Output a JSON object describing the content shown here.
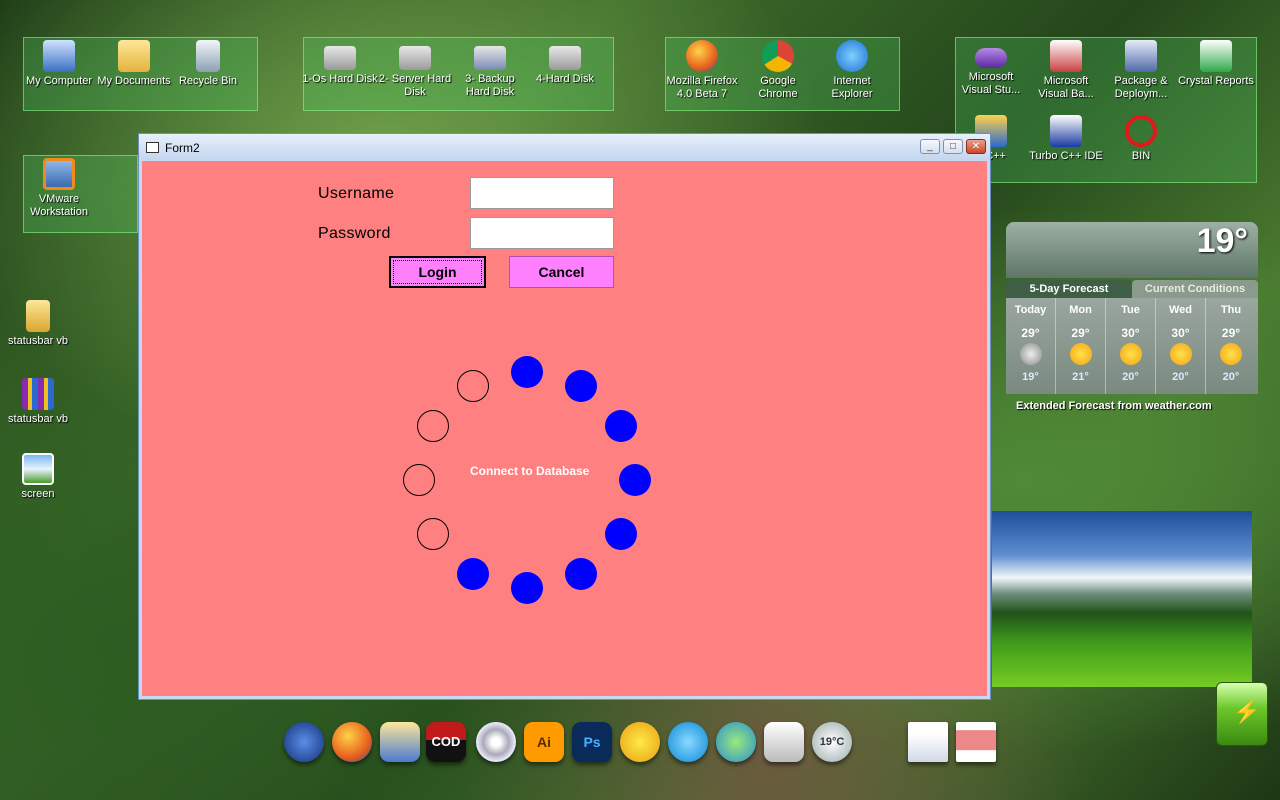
{
  "desktop": {
    "fence1": [
      {
        "label": "My Computer",
        "icon": "computer-icon"
      },
      {
        "label": "My Documents",
        "icon": "folder-icon"
      },
      {
        "label": "Recycle Bin",
        "icon": "recycle-bin-icon"
      }
    ],
    "fence2": [
      {
        "label": "1-Os Hard Disk",
        "icon": "hard-disk-icon"
      },
      {
        "label": "2- Server Hard Disk",
        "icon": "hard-disk-icon"
      },
      {
        "label": "3- Backup Hard Disk",
        "icon": "hard-disk-icon"
      },
      {
        "label": "4-Hard Disk",
        "icon": "hard-disk-icon"
      }
    ],
    "fence3": [
      {
        "label": "Mozilla Firefox 4.0 Beta 7",
        "icon": "firefox-icon"
      },
      {
        "label": "Google Chrome",
        "icon": "chrome-icon"
      },
      {
        "label": "Internet Explorer",
        "icon": "ie-icon"
      }
    ],
    "fence4": [
      {
        "label": "Microsoft Visual Stu...",
        "icon": "visual-studio-icon"
      },
      {
        "label": "Microsoft Visual Ba...",
        "icon": "visual-basic-icon"
      },
      {
        "label": "Package & Deploym...",
        "icon": "package-icon"
      },
      {
        "label": "Crystal Reports",
        "icon": "crystal-reports-icon"
      },
      {
        "label": "d C++",
        "icon": "cpp-icon"
      },
      {
        "label": "Turbo C++ IDE",
        "icon": "turbo-cpp-icon"
      },
      {
        "label": "BIN",
        "icon": "bin-icon"
      }
    ],
    "fence5": [
      {
        "label": "VMware Workstation",
        "icon": "vmware-icon"
      }
    ],
    "loose": [
      {
        "label": "statusbar vb",
        "icon": "folder-icon"
      },
      {
        "label": "statusbar vb",
        "icon": "archive-icon"
      },
      {
        "label": "screen",
        "icon": "image-icon"
      }
    ]
  },
  "window": {
    "title": "Form2",
    "username_label": "Username",
    "password_label": "Password",
    "username_value": "",
    "password_value": "",
    "login_label": "Login",
    "cancel_label": "Cancel",
    "status_text": "Connect to Database",
    "colors": {
      "client_bg": "#ff8080",
      "button_bg": "#ff80ff",
      "dot_on": "#0000ff"
    },
    "dots": [
      true,
      true,
      true,
      true,
      true,
      true,
      true,
      true,
      false,
      false,
      false,
      false
    ]
  },
  "weather": {
    "temperature": "19°",
    "tab_forecast": "5-Day Forecast",
    "tab_current": "Current Conditions",
    "days": [
      {
        "day": "Today",
        "hi": "29°",
        "lo": "19°",
        "icon": "moon-cloud-icon"
      },
      {
        "day": "Mon",
        "hi": "29°",
        "lo": "21°",
        "icon": "sun-cloud-icon"
      },
      {
        "day": "Tue",
        "hi": "30°",
        "lo": "20°",
        "icon": "sun-icon"
      },
      {
        "day": "Wed",
        "hi": "30°",
        "lo": "20°",
        "icon": "sun-icon"
      },
      {
        "day": "Thu",
        "hi": "29°",
        "lo": "20°",
        "icon": "sun-cloud-icon"
      }
    ],
    "footer": "Extended Forecast from weather.com"
  },
  "dock": {
    "items": [
      {
        "icon": "windows-start-icon",
        "text": ""
      },
      {
        "icon": "firefox-icon",
        "text": ""
      },
      {
        "icon": "explorer-folder-icon",
        "text": ""
      },
      {
        "icon": "cod-game-icon",
        "text": "COD"
      },
      {
        "icon": "cd-icon",
        "text": ""
      },
      {
        "icon": "illustrator-icon",
        "text": "Ai"
      },
      {
        "icon": "photoshop-icon",
        "text": "Ps"
      },
      {
        "icon": "yahoo-messenger-icon",
        "text": ""
      },
      {
        "icon": "skype-icon",
        "text": ""
      },
      {
        "icon": "msn-messenger-icon",
        "text": ""
      },
      {
        "icon": "calendar-icon",
        "text": ""
      },
      {
        "icon": "weather-icon",
        "text": "19°C"
      },
      {
        "icon": "window-firefox-icon",
        "text": ""
      },
      {
        "icon": "window-thumb-icon",
        "text": ""
      }
    ]
  }
}
